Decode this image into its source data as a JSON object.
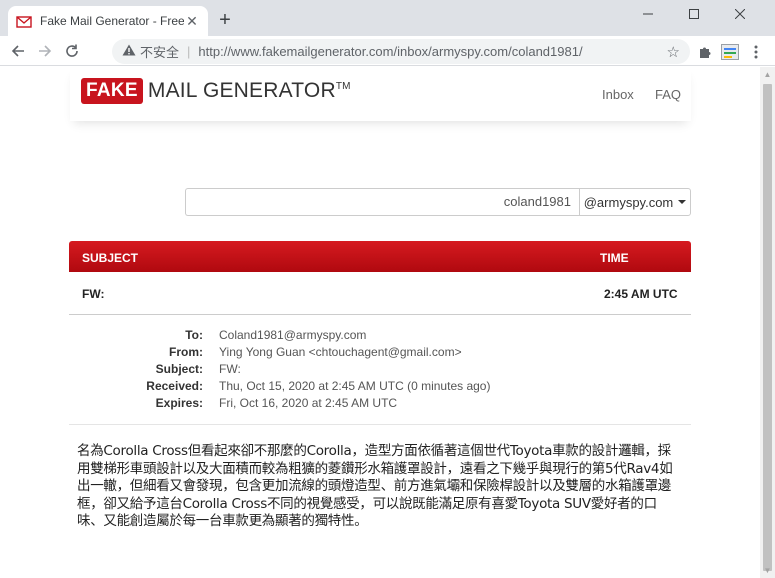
{
  "browser": {
    "tab_title": "Fake Mail Generator - Free tem",
    "insecure_label": "不安全",
    "url": "http://www.fakemailgenerator.com/inbox/armyspy.com/coland1981/"
  },
  "site": {
    "logo_fake": "FAKE",
    "logo_rest": "MAIL GENERATOR",
    "logo_tm": "TM",
    "nav": {
      "inbox": "Inbox",
      "faq": "FAQ"
    },
    "username": "coland1981",
    "domain": "@armyspy.com"
  },
  "inbox": {
    "col_subject": "SUBJECT",
    "col_time": "TIME",
    "row_subject": "FW:",
    "row_time": "2:45 AM UTC"
  },
  "email": {
    "to_label": "To:",
    "to": "Coland1981@armyspy.com",
    "from_label": "From:",
    "from": "Ying Yong Guan <chtouchagent@gmail.com>",
    "subject_label": "Subject:",
    "subject": "FW:",
    "received_label": "Received:",
    "received": "Thu, Oct 15, 2020 at 2:45 AM UTC (0 minutes ago)",
    "expires_label": "Expires:",
    "expires": "Fri, Oct 16, 2020 at 2:45 AM UTC",
    "body": "名為Corolla Cross但看起來卻不那麼的Corolla，造型方面依循著這個世代Toyota車款的設計邏輯，採用雙梯形車頭設計以及大面積而較為粗獷的菱鑽形水箱護罩設計，遠看之下幾乎與現行的第5代Rav4如出一轍，但細看又會發現，包含更加流線的頭燈造型、前方進氣壩和保險桿設計以及雙層的水箱護罩邊框，卻又給予這台Corolla Cross不同的視覺感受，可以說既能滿足原有喜愛Toyota SUV愛好者的口味、又能創造屬於每一台車款更為顯著的獨特性。"
  }
}
